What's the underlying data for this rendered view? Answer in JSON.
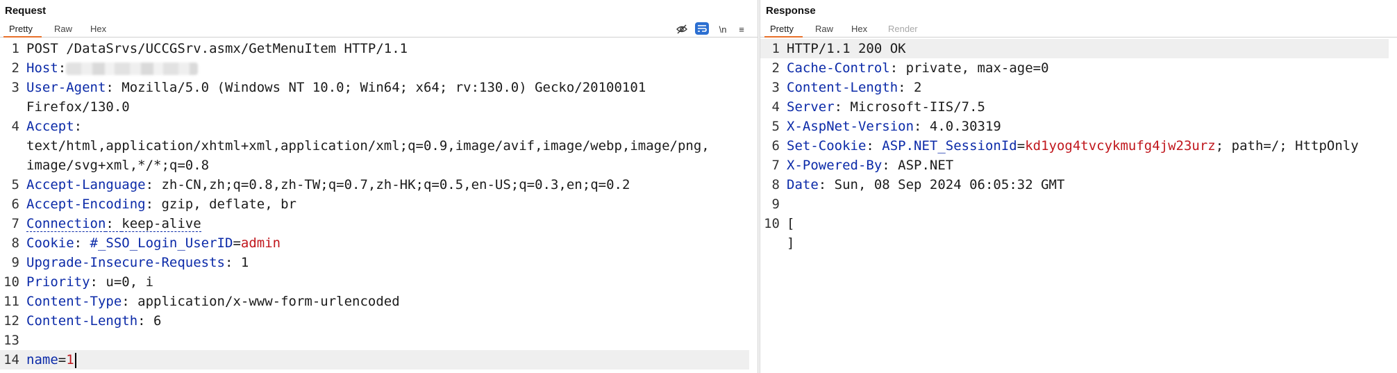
{
  "request": {
    "title": "Request",
    "tabs": [
      "Pretty",
      "Raw",
      "Hex"
    ],
    "toolbar": {
      "eye_off": "eye-off",
      "wrap": "wrap",
      "newline_label": "\\n",
      "menu": "≡"
    },
    "lines": [
      {
        "n": "1",
        "plain": "POST /DataSrvs/UCCGSrv.asmx/GetMenuItem HTTP/1.1"
      },
      {
        "n": "2",
        "key": "Host",
        "sep": ":"
      },
      {
        "n": "3",
        "key": "User-Agent",
        "sep": ": ",
        "value": "Mozilla/5.0 (Windows NT 10.0; Win64; x64; rv:130.0) Gecko/20100101",
        "cont": [
          "Firefox/130.0"
        ]
      },
      {
        "n": "4",
        "key": "Accept",
        "sep": ":",
        "cont": [
          "text/html,application/xhtml+xml,application/xml;q=0.9,image/avif,image/webp,image/png,",
          "image/svg+xml,*/*;q=0.8"
        ]
      },
      {
        "n": "5",
        "key": "Accept-Language",
        "sep": ": ",
        "value": "zh-CN,zh;q=0.8,zh-TW;q=0.7,zh-HK;q=0.5,en-US;q=0.3,en;q=0.2"
      },
      {
        "n": "6",
        "key": "Accept-Encoding",
        "sep": ": ",
        "value": "gzip, deflate, br"
      },
      {
        "n": "7",
        "key": "Connection",
        "sep": ": ",
        "value": "keep-alive"
      },
      {
        "n": "8",
        "key": "Cookie",
        "sep": ": ",
        "ckey": "#_SSO_Login_UserID",
        "cval": "admin"
      },
      {
        "n": "9",
        "key": "Upgrade-Insecure-Requests",
        "sep": ": ",
        "value": "1"
      },
      {
        "n": "10",
        "key": "Priority",
        "sep": ": ",
        "value": "u=0, i"
      },
      {
        "n": "11",
        "key": "Content-Type",
        "sep": ": ",
        "value": "application/x-www-form-urlencoded"
      },
      {
        "n": "12",
        "key": "Content-Length",
        "sep": ": ",
        "value": "6"
      },
      {
        "n": "13"
      },
      {
        "n": "14",
        "pkey": "name",
        "pval": "1"
      }
    ]
  },
  "response": {
    "title": "Response",
    "tabs": [
      "Pretty",
      "Raw",
      "Hex",
      "Render"
    ],
    "lines": [
      {
        "n": "1",
        "plain": "HTTP/1.1 200 OK"
      },
      {
        "n": "2",
        "key": "Cache-Control",
        "sep": ": ",
        "value": "private, max-age=0"
      },
      {
        "n": "3",
        "key": "Content-Length",
        "sep": ": ",
        "value": "2"
      },
      {
        "n": "4",
        "key": "Server",
        "sep": ": ",
        "value": "Microsoft-IIS/7.5"
      },
      {
        "n": "5",
        "key": "X-AspNet-Version",
        "sep": ": ",
        "value": "4.0.30319"
      },
      {
        "n": "6",
        "key": "Set-Cookie",
        "sep": ": ",
        "ckey": "ASP.NET_SessionId",
        "cval": "kd1yog4tvcykmufg4jw23urz",
        "rest": "; path=/; HttpOnly"
      },
      {
        "n": "7",
        "key": "X-Powered-By",
        "sep": ": ",
        "value": "ASP.NET"
      },
      {
        "n": "8",
        "key": "Date",
        "sep": ": ",
        "value": "Sun, 08 Sep 2024 06:05:32 GMT"
      },
      {
        "n": "9"
      },
      {
        "n": "10",
        "plain": "[",
        "cont": [
          "]"
        ]
      }
    ]
  },
  "colors": {
    "key": "#0b2aa8",
    "cookie_value": "#c0161c",
    "tab_accent": "#e8702a",
    "active_icon": "#2c6fd1"
  }
}
